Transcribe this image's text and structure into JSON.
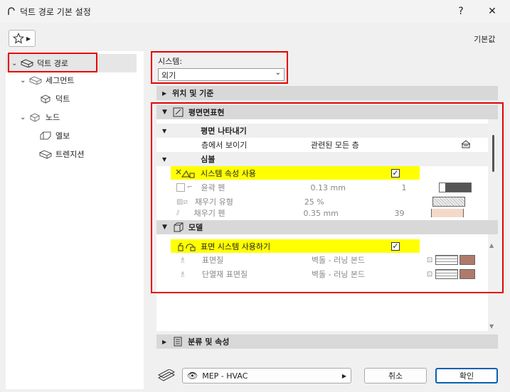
{
  "window": {
    "title": "덕트 경로 기본 설정",
    "help": "?",
    "close": "✕"
  },
  "toolbar": {
    "favorites_icon": "star-icon",
    "defaults_label": "기본값"
  },
  "tree": {
    "items": [
      {
        "label": "덕트 경로"
      },
      {
        "label": "세그먼트"
      },
      {
        "label": "덕트"
      },
      {
        "label": "노드"
      },
      {
        "label": "엘보"
      },
      {
        "label": "트렌지션"
      }
    ]
  },
  "system": {
    "label": "시스템:",
    "value": "외기"
  },
  "sections": {
    "position": "위치 및 기준",
    "floorplan": "평면면표현",
    "model": "모델",
    "classification": "분류 및 속성"
  },
  "floorplan": {
    "display_group": "평면 나타내기",
    "show_on_story": "층에서 보이기",
    "show_on_story_value": "관련된 모든 층",
    "symbol_group": "심볼",
    "use_system_attr": "시스템 속성 사용",
    "contour_pen": "윤곽 펜",
    "contour_pen_value": "0.13 mm",
    "contour_pen_num": "1",
    "fill_type": "채우기 유형",
    "fill_type_value": "25 %",
    "fill_pen": "채우기 펜",
    "fill_pen_value": "0.35 mm",
    "fill_pen_num": "39"
  },
  "model": {
    "use_surface_system": "표면 시스템 사용하기",
    "surface": "표면질",
    "surface_value": "벽돌 - 러닝 본드",
    "insulation_surface": "단열재 표면질",
    "insulation_surface_value": "벽돌 - 러닝 본드"
  },
  "footer": {
    "view_label": "MEP - HVAC",
    "cancel": "취소",
    "ok": "확인"
  },
  "colors": {
    "highlight": "#ffff00",
    "annotation": "#e60000",
    "brick": "#b07a6a"
  }
}
